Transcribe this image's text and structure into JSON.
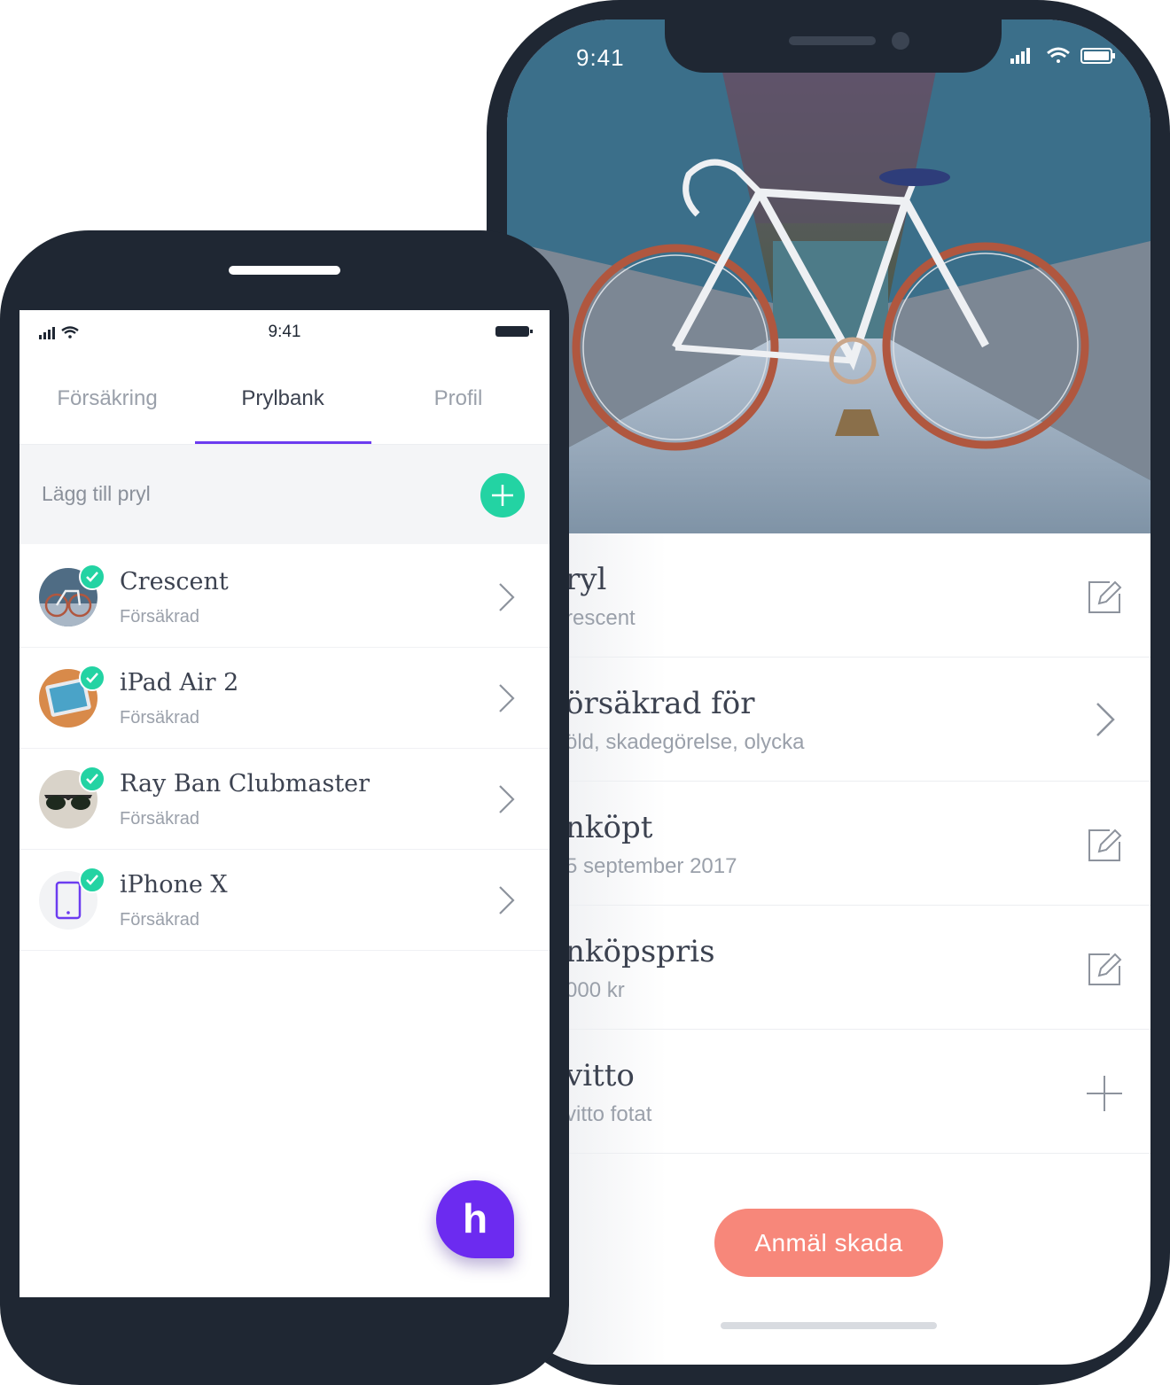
{
  "colors": {
    "frame": "#1f2733",
    "accent_green": "#23d3a3",
    "accent_purple": "#6c3cf0",
    "report_button": "#f7877a"
  },
  "detail_phone": {
    "status_time": "9:41",
    "rows": [
      {
        "title": "ryl",
        "subtitle": "rescent",
        "action": "edit-icon"
      },
      {
        "title": "örsäkrad för",
        "subtitle": "öld, skadegörelse, olycka",
        "action": "chevron-right-icon"
      },
      {
        "title": "nköpt",
        "subtitle": "5 september 2017",
        "action": "edit-icon"
      },
      {
        "title": "nköpspris",
        "subtitle": "000 kr",
        "action": "edit-icon"
      },
      {
        "title": "vitto",
        "subtitle": "vitto fotat",
        "action": "plus-icon"
      }
    ],
    "report_button": "Anmäl skada"
  },
  "list_phone": {
    "status_time": "9:41",
    "tabs": [
      "Försäkring",
      "Prylbank",
      "Profil"
    ],
    "active_tab": "Prylbank",
    "add_label": "Lägg till pryl",
    "items": [
      {
        "name": "Crescent",
        "status": "Försäkrad"
      },
      {
        "name": "iPad Air 2",
        "status": "Försäkrad"
      },
      {
        "name": "Ray Ban Clubmaster",
        "status": "Försäkrad"
      },
      {
        "name": "iPhone X",
        "status": "Försäkrad"
      }
    ],
    "fab_label": "h"
  }
}
